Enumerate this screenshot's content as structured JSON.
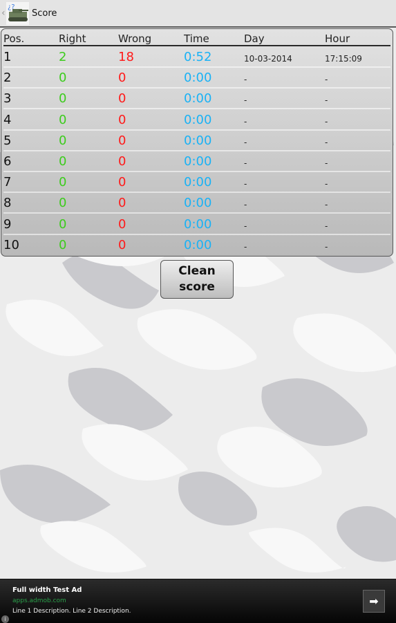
{
  "actionbar": {
    "title": "Score",
    "back_icon": "chevron-left-icon",
    "app_icon": "tank-app-icon"
  },
  "table": {
    "headers": [
      "Pos.",
      "Right",
      "Wrong",
      "Time",
      "Day",
      "Hour"
    ],
    "rows": [
      {
        "pos": "1",
        "right": "2",
        "wrong": "18",
        "time": "0:52",
        "day": "10-03-2014",
        "hour": "17:15:09"
      },
      {
        "pos": "2",
        "right": "0",
        "wrong": "0",
        "time": "0:00",
        "day": "-",
        "hour": "-"
      },
      {
        "pos": "3",
        "right": "0",
        "wrong": "0",
        "time": "0:00",
        "day": "-",
        "hour": "-"
      },
      {
        "pos": "4",
        "right": "0",
        "wrong": "0",
        "time": "0:00",
        "day": "-",
        "hour": "-"
      },
      {
        "pos": "5",
        "right": "0",
        "wrong": "0",
        "time": "0:00",
        "day": "-",
        "hour": "-"
      },
      {
        "pos": "6",
        "right": "0",
        "wrong": "0",
        "time": "0:00",
        "day": "-",
        "hour": "-"
      },
      {
        "pos": "7",
        "right": "0",
        "wrong": "0",
        "time": "0:00",
        "day": "-",
        "hour": "-"
      },
      {
        "pos": "8",
        "right": "0",
        "wrong": "0",
        "time": "0:00",
        "day": "-",
        "hour": "-"
      },
      {
        "pos": "9",
        "right": "0",
        "wrong": "0",
        "time": "0:00",
        "day": "-",
        "hour": "-"
      },
      {
        "pos": "10",
        "right": "0",
        "wrong": "0",
        "time": "0:00",
        "day": "-",
        "hour": "-"
      }
    ],
    "colors": {
      "right": "#3ccc1c",
      "wrong": "#ff1a1a",
      "time": "#1ab2f5"
    }
  },
  "clean_button": {
    "line1": "Clean",
    "line2": "score"
  },
  "ad": {
    "title": "Full width Test Ad",
    "url": "apps.admob.com",
    "description": "Line 1 Description. Line 2 Description.",
    "go_icon": "arrow-right-icon",
    "info_icon": "info-icon"
  }
}
